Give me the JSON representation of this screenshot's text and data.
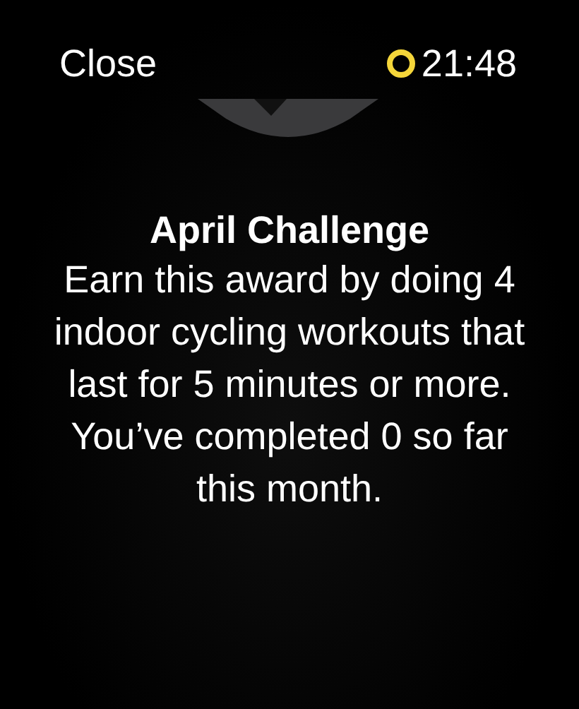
{
  "header": {
    "close": "Close",
    "time": "21:48"
  },
  "award": {
    "title": "April Challenge",
    "description": "Earn this award by doing 4 indoor cycling workouts that last for 5 minutes or more. You’ve completed 0 so far this month."
  }
}
